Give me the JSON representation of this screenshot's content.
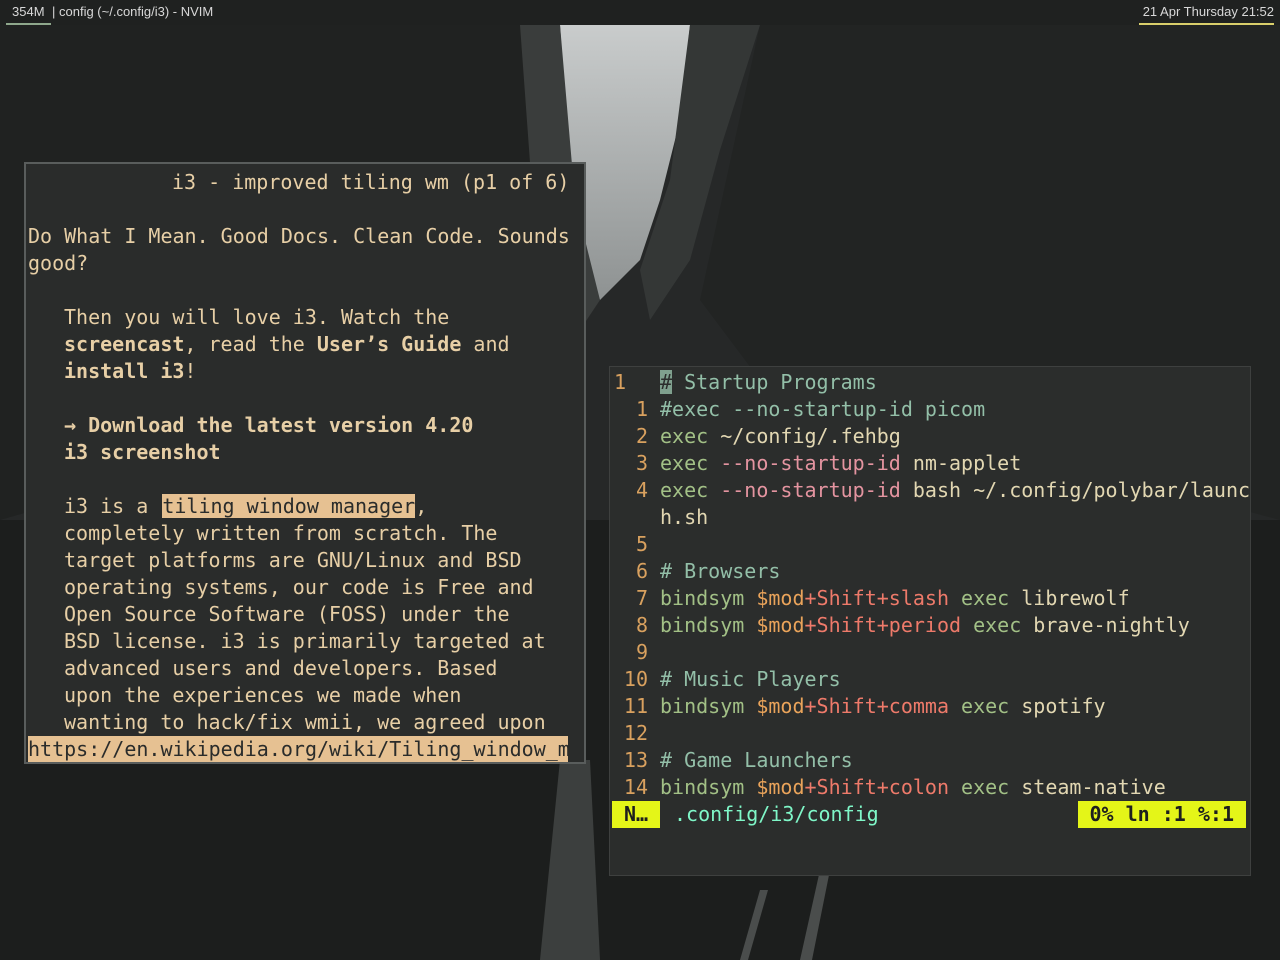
{
  "topbar": {
    "memory": "354M",
    "window_title": "config (~/.config/i3) - NVIM",
    "clock": "21 Apr Thursday 21:52"
  },
  "browser": {
    "header": "i3 - improved tiling wm (p1 of 6)",
    "lines": {
      "l1": "Do What I Mean. Good Docs. Clean Code. Sounds",
      "l2": "good?",
      "l3": "Then you will love i3. Watch the",
      "screencast": "screencast",
      "read_the": ", read the ",
      "users_guide": "User’s Guide",
      "and": " and",
      "install": "install i3",
      "bang": "!",
      "download": "→ Download the latest version 4.20",
      "screenshot": "i3 screenshot",
      "i3_is_a": "i3 is a ",
      "tiling_link_first": "t",
      "tiling_link_rest": "iling window manager",
      "comma": ",",
      "p1": "completely written from scratch. The",
      "p2": "target platforms are GNU/Linux and BSD",
      "p3": "operating systems, our code is Free and",
      "p4": "Open Source Software (FOSS) under the",
      "p5": "BSD license. i3 is primarily targeted at",
      "p6": "advanced users and developers. Based",
      "p7": "upon the experiences we made when",
      "p8": "wanting to hack/fix wmii, we agreed upon"
    },
    "status_url": "https://en.wikipedia.org/wiki/Tiling_window_m"
  },
  "editor": {
    "current_line_number": "1",
    "lines": [
      {
        "n": "",
        "parts": []
      },
      {
        "n": "1",
        "parts": [
          {
            "c": "cmt",
            "t": "#exec --no-startup-id picom"
          }
        ]
      },
      {
        "n": "2",
        "parts": [
          {
            "c": "kw",
            "t": "exec "
          },
          {
            "c": "plain",
            "t": "~/config/.fehbg"
          }
        ]
      },
      {
        "n": "3",
        "parts": [
          {
            "c": "kw",
            "t": "exec "
          },
          {
            "c": "flag",
            "t": "--no-startup-id "
          },
          {
            "c": "plain",
            "t": "nm-applet"
          }
        ]
      },
      {
        "n": "4",
        "parts": [
          {
            "c": "kw",
            "t": "exec "
          },
          {
            "c": "flag",
            "t": "--no-startup-id "
          },
          {
            "c": "plain",
            "t": "bash ~/.config/polybar/launc"
          }
        ]
      },
      {
        "n": "",
        "parts": [
          {
            "c": "plain",
            "t": "h.sh"
          }
        ]
      },
      {
        "n": "5",
        "parts": []
      },
      {
        "n": "6",
        "parts": [
          {
            "c": "cmt",
            "t": "# Browsers"
          }
        ]
      },
      {
        "n": "7",
        "parts": [
          {
            "c": "kw",
            "t": "bindsym "
          },
          {
            "c": "var",
            "t": "$mod"
          },
          {
            "c": "key",
            "t": "+Shift+slash "
          },
          {
            "c": "kw",
            "t": "exec "
          },
          {
            "c": "plain",
            "t": "librewolf"
          }
        ]
      },
      {
        "n": "8",
        "parts": [
          {
            "c": "kw",
            "t": "bindsym "
          },
          {
            "c": "var",
            "t": "$mod"
          },
          {
            "c": "key",
            "t": "+Shift+period "
          },
          {
            "c": "kw",
            "t": "exec "
          },
          {
            "c": "plain",
            "t": "brave-nightly"
          }
        ]
      },
      {
        "n": "9",
        "parts": []
      },
      {
        "n": "10",
        "parts": [
          {
            "c": "cmt",
            "t": "# Music Players"
          }
        ]
      },
      {
        "n": "11",
        "parts": [
          {
            "c": "kw",
            "t": "bindsym "
          },
          {
            "c": "var",
            "t": "$mod"
          },
          {
            "c": "key",
            "t": "+Shift+comma "
          },
          {
            "c": "kw",
            "t": "exec "
          },
          {
            "c": "plain",
            "t": "spotify"
          }
        ]
      },
      {
        "n": "12",
        "parts": []
      },
      {
        "n": "13",
        "parts": [
          {
            "c": "cmt",
            "t": "# Game Launchers"
          }
        ]
      },
      {
        "n": "14",
        "parts": [
          {
            "c": "kw",
            "t": "bindsym "
          },
          {
            "c": "var",
            "t": "$mod"
          },
          {
            "c": "key",
            "t": "+Shift+colon "
          },
          {
            "c": "kw",
            "t": "exec "
          },
          {
            "c": "plain",
            "t": "steam-native"
          }
        ]
      }
    ],
    "first_line": {
      "cursor_char": "#",
      "rest": " Startup Programs"
    },
    "statusline": {
      "mode": "N…",
      "file": ".config/i3/config",
      "position": "0% ln :1 %:1"
    }
  },
  "colors": {
    "accent_mode": "#e4f518",
    "link_highlight": "#e6c192",
    "memory_underline": "#8fa88c",
    "clock_underline": "#d9cf6b"
  }
}
